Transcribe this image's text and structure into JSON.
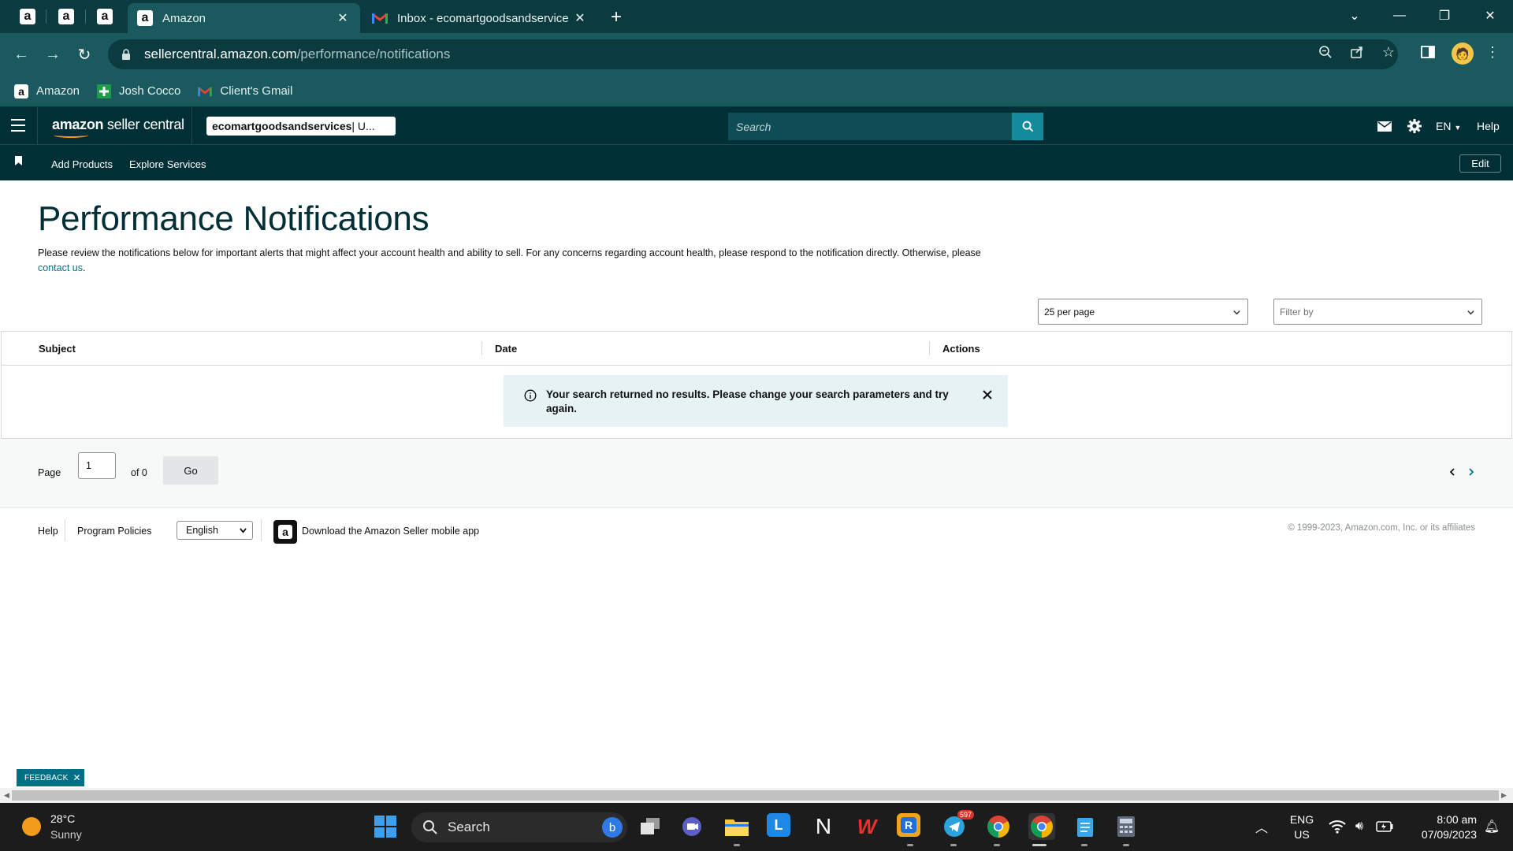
{
  "browser": {
    "pinned_tabs": [
      "a",
      "a",
      "a"
    ],
    "tabs": [
      {
        "title": "Amazon",
        "active": true
      },
      {
        "title": "Inbox - ecomartgoodsandservice",
        "active": false
      }
    ],
    "url_host": "sellercentral.amazon.com",
    "url_path": "/performance/notifications",
    "bookmarks": [
      {
        "label": "Amazon",
        "icon": "amazon-icon"
      },
      {
        "label": "Josh Cocco",
        "icon": "green-plus-icon"
      },
      {
        "label": "Client's Gmail",
        "icon": "gmail-icon"
      }
    ]
  },
  "header": {
    "logo_bold": "amazon",
    "logo_rest": " seller central",
    "account_name": "ecomartgoodsandservices",
    "account_suffix": " | U...",
    "search_placeholder": "Search",
    "language": "EN",
    "help": "Help"
  },
  "subnav": {
    "links": [
      "Add Products",
      "Explore Services"
    ],
    "edit": "Edit"
  },
  "page": {
    "title": "Performance Notifications",
    "intro": "Please review the notifications below for important alerts that might affect your account health and ability to sell. For any concerns regarding account health, please respond to the notification directly. Otherwise, please ",
    "intro_link": "contact us",
    "intro_end": ".",
    "per_page": "25 per page",
    "filter_placeholder": "Filter by"
  },
  "table": {
    "columns": [
      "Subject",
      "Date",
      "Actions"
    ],
    "empty_message": "Your search returned no results. Please change your search parameters and try again."
  },
  "pager": {
    "page_label": "Page",
    "page_value": "1",
    "of_label": "of 0",
    "go": "Go"
  },
  "footer": {
    "help": "Help",
    "policies": "Program Policies",
    "language": "English",
    "app_link": "Download the Amazon Seller mobile app",
    "copyright": "© 1999-2023, Amazon.com, Inc. or its affiliates"
  },
  "feedback": "FEEDBACK",
  "taskbar": {
    "temperature": "28°C",
    "condition": "Sunny",
    "search_label": "Search",
    "telegram_badge": "597",
    "lang_top": "ENG",
    "lang_bottom": "US",
    "time": "8:00 am",
    "date": "07/09/2023"
  },
  "colors": {
    "header_bg": "#002f36",
    "link": "#007185",
    "alert_bg": "#e6f2f3",
    "browser_frame": "#1a5a5e"
  }
}
